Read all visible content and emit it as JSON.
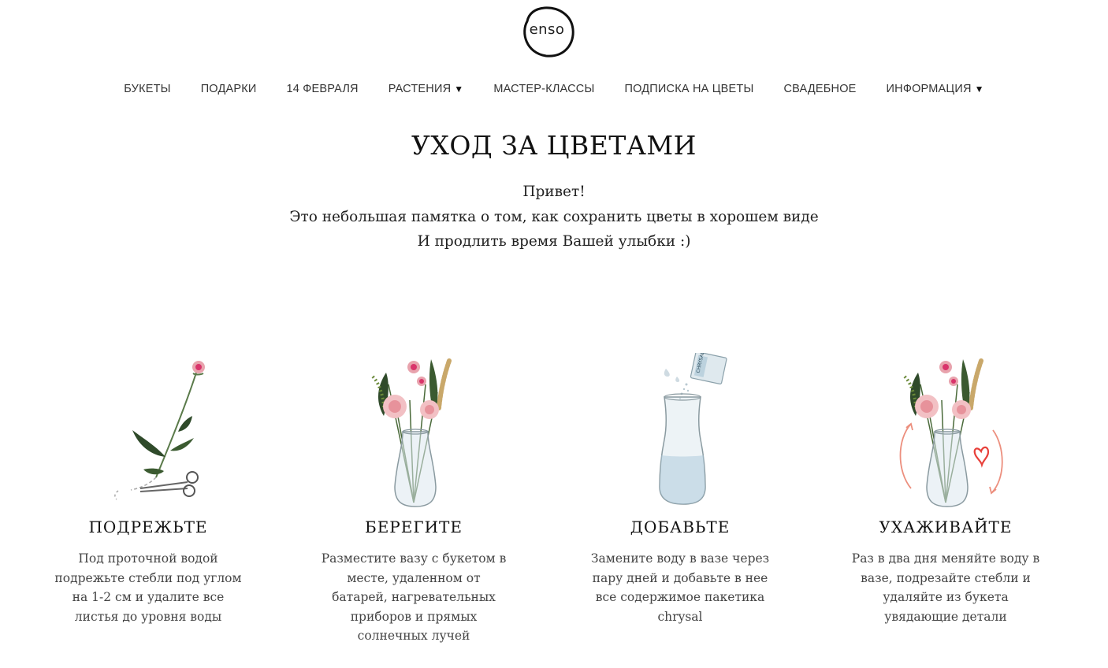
{
  "logo": {
    "text": "enso"
  },
  "nav": {
    "items": [
      {
        "label": "БУКЕТЫ",
        "has_dropdown": false
      },
      {
        "label": "ПОДАРКИ",
        "has_dropdown": false
      },
      {
        "label": "14 ФЕВРАЛЯ",
        "has_dropdown": false
      },
      {
        "label": "РАСТЕНИЯ",
        "has_dropdown": true
      },
      {
        "label": "МАСТЕР-КЛАССЫ",
        "has_dropdown": false
      },
      {
        "label": "ПОДПИСКА НА ЦВЕТЫ",
        "has_dropdown": false
      },
      {
        "label": "СВАДЕБНОЕ",
        "has_dropdown": false
      },
      {
        "label": "ИНФОРМАЦИЯ",
        "has_dropdown": true
      }
    ],
    "dropdown_glyph": "▼"
  },
  "page": {
    "title": "УХОД ЗА ЦВЕТАМИ",
    "intro": [
      "Привет!",
      "Это небольшая памятка о том, как сохранить цветы в хорошем виде",
      "И продлить время Вашей улыбки :)"
    ]
  },
  "steps": [
    {
      "title": "ПОДРЕЖЬТЕ",
      "text": "Под проточной водой подрежьте стебли под углом на 1-2 см и удалите все листья до уровня воды",
      "icon": "flower-scissors-icon"
    },
    {
      "title": "БЕРЕГИТЕ",
      "text": "Разместите вазу с букетом в месте, удаленном от батарей, нагревательных приборов и прямых солнечных лучей",
      "icon": "bouquet-vase-icon"
    },
    {
      "title": "ДОБАВЬТЕ",
      "text": "Замените воду в вазе через пару дней и добавьте в нее все содержимое пакетика chrysal",
      "icon": "vase-sachet-icon",
      "sachet_label": "CHRYSAL"
    },
    {
      "title": "УХАЖИВАЙТЕ",
      "text": "Раз в два дня меняйте воду в вазе, подрезайте стебли и удаляйте из букета увядающие детали",
      "icon": "bouquet-heart-icon"
    }
  ],
  "colors": {
    "text": "#111111",
    "muted": "#444444",
    "rose": "#e8a3ad",
    "rose_center": "#d9346b",
    "leaf": "#2f4a2a",
    "accent_red": "#e8403a",
    "arrow": "#ec8f7e"
  }
}
